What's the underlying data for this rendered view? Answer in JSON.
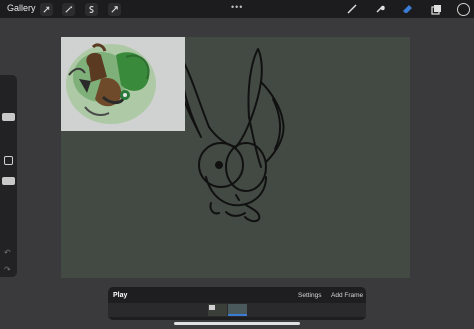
{
  "topbar": {
    "gallery_label": "Gallery",
    "left_tools": [
      "wrench-icon",
      "magic-wand-icon",
      "selection-icon",
      "transform-arrow-icon"
    ],
    "more": "•••",
    "right_tools": [
      "brush-icon",
      "smudge-icon",
      "eraser-icon",
      "layers-icon"
    ],
    "active_tool": "eraser",
    "active_color": "#1a1a1a"
  },
  "sidebar": {
    "undo_glyph": "↶",
    "redo_glyph": "↷"
  },
  "canvas": {
    "background": "#434a44"
  },
  "animation": {
    "play_label": "Play",
    "settings_label": "Settings",
    "add_frame_label": "Add Frame"
  },
  "colors": {
    "accent": "#3a7bd5",
    "toolbar": "#1c1c1e",
    "reference_green": "#5f9a58"
  }
}
